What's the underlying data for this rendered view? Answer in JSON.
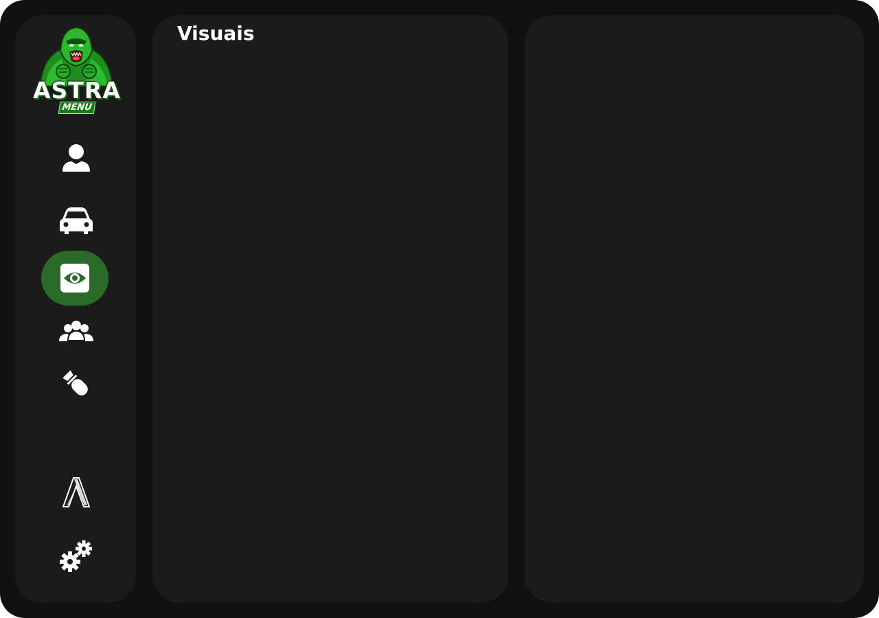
{
  "app": {
    "logo_text": "ASTRA",
    "logo_subtext": "MENU",
    "accent_color": "#2a6b2a",
    "logo_green": "#22c222"
  },
  "sidebar": {
    "items": [
      {
        "icon": "user-icon",
        "active": false
      },
      {
        "icon": "car-icon",
        "active": false
      },
      {
        "icon": "eye-icon",
        "active": true
      },
      {
        "icon": "group-icon",
        "active": false
      },
      {
        "icon": "bomb-icon",
        "active": false
      },
      {
        "icon": "ascent-logo-icon",
        "active": false
      },
      {
        "icon": "gears-icon",
        "active": false
      }
    ]
  },
  "main": {
    "title": "Visuais"
  }
}
